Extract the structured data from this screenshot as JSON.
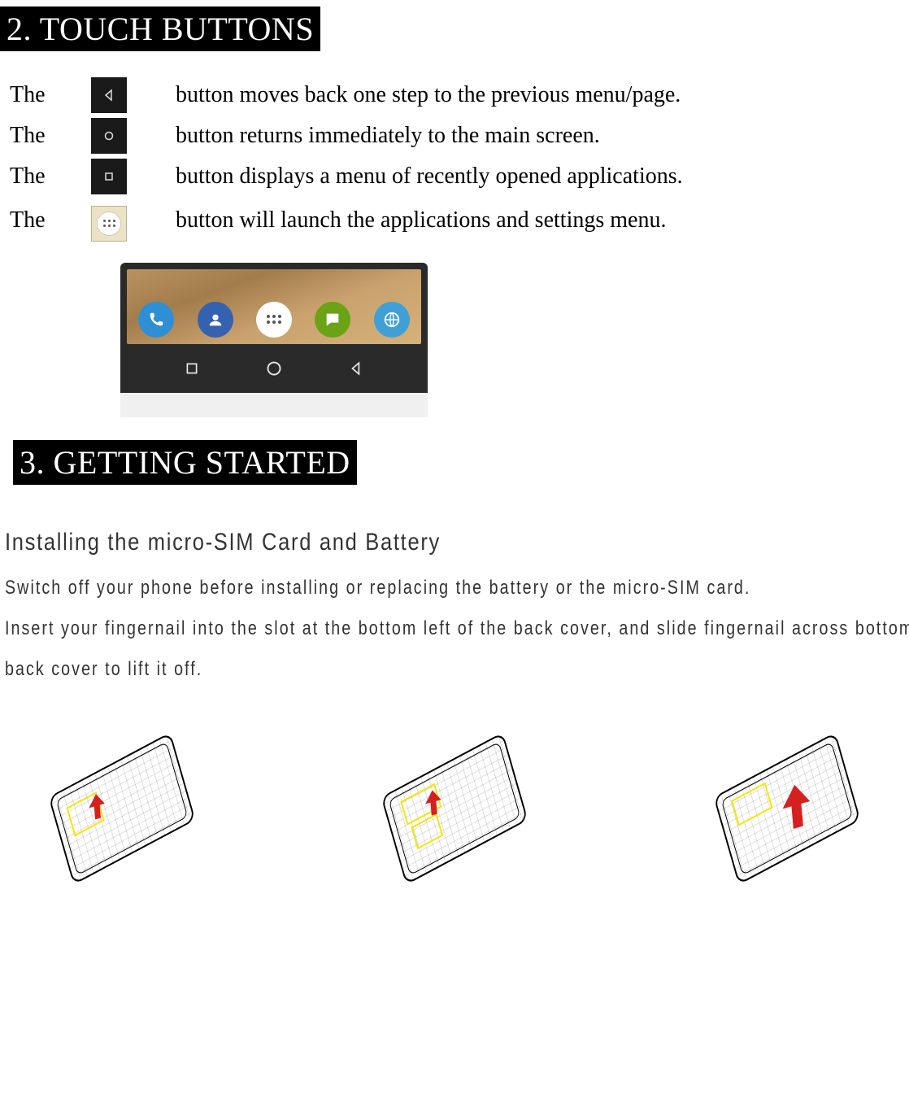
{
  "section2": {
    "heading": "2. TOUCH BUTTONS",
    "rows": [
      {
        "the": "The",
        "icon": "back-triangle-icon",
        "desc": "button moves back one step to the previous menu/page."
      },
      {
        "the": "The",
        "icon": "home-circle-icon",
        "desc": "button returns immediately to the main screen."
      },
      {
        "the": "The",
        "icon": "recent-square-icon",
        "desc": "button displays a menu of recently opened applications."
      },
      {
        "the": "The",
        "icon": "apps-grid-icon",
        "desc": "button will launch the applications and settings menu."
      }
    ]
  },
  "section3": {
    "heading": "3. GETTING STARTED",
    "subheading": "Installing the micro-SIM Card and Battery",
    "p1": "Switch off your phone before installing or replacing the battery or the micro-SIM card.",
    "p2": "Insert your fingernail into the slot at the bottom left of the back cover, and slide fingernail across bottom of back cover to lift it off."
  },
  "phoneDock": {
    "items": [
      "phone-icon",
      "contacts-icon",
      "apps-launcher-icon",
      "messages-icon",
      "browser-icon"
    ]
  },
  "phoneNav": {
    "items": [
      "recent-square-icon",
      "home-circle-icon",
      "back-triangle-icon"
    ]
  },
  "diagrams": {
    "items": [
      "remove-cover-diagram",
      "insert-sim-diagram",
      "insert-battery-diagram"
    ]
  }
}
